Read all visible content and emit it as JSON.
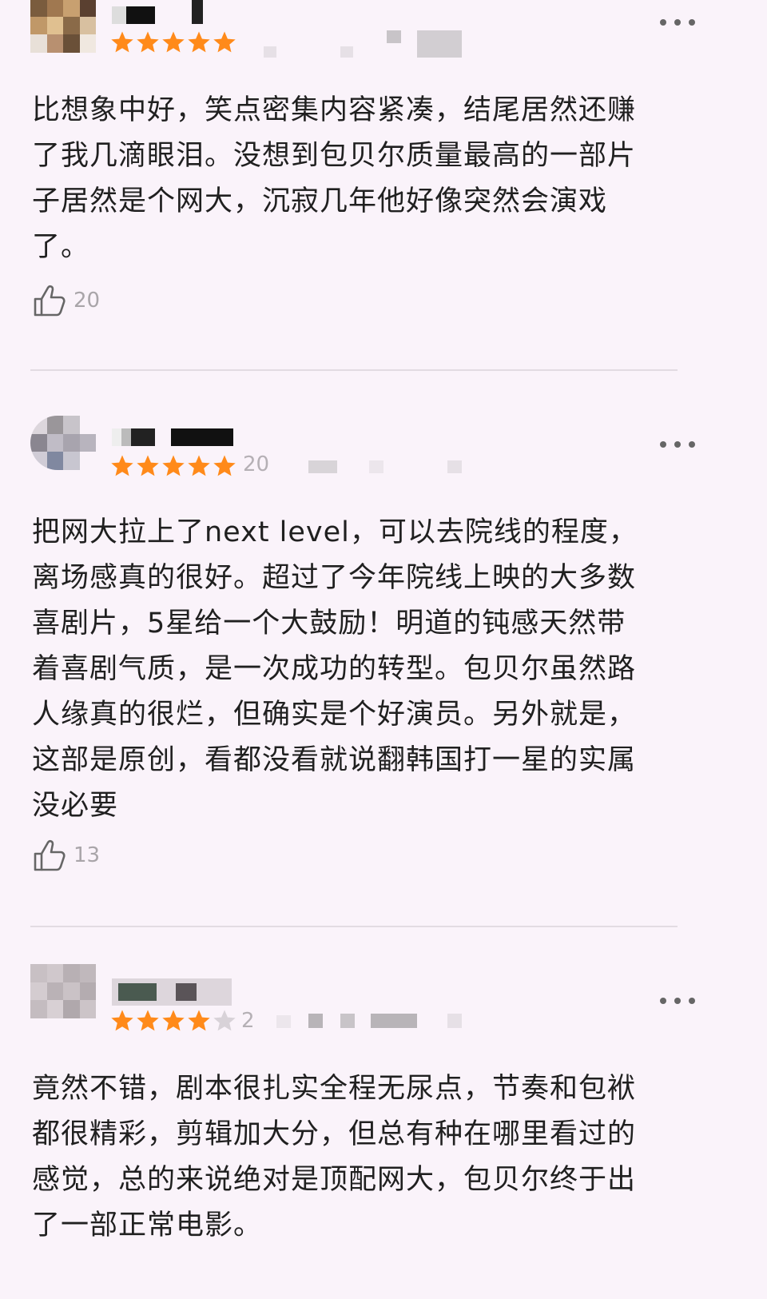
{
  "colors": {
    "background": "#faf3fa",
    "star_filled": "#ff8a1a",
    "star_empty": "#d8d2d8",
    "text": "#202020",
    "muted": "#a9a5a9",
    "divider": "#e2dbe2"
  },
  "icons": {
    "more": "more-horizontal-icon",
    "like": "thumbs-up-icon",
    "star": "star-icon"
  },
  "reviews": [
    {
      "rating": 5,
      "meta": "",
      "body": "比想象中好，笑点密集内容紧凑，结尾居然还赚\n了我几滴眼泪。没想到包贝尔质量最高的一部片\n子居然是个网大，沉寂几年他好像突然会演戏\n了。",
      "likes": "20"
    },
    {
      "rating": 5,
      "meta": "20",
      "body": "把网大拉上了next level，可以去院线的程度，\n离场感真的很好。超过了今年院线上映的大多数\n喜剧片，5星给一个大鼓励！明道的钝感天然带\n着喜剧气质，是一次成功的转型。包贝尔虽然路\n人缘真的很烂，但确实是个好演员。另外就是，\n这部是原创，看都没看就说翻韩国打一星的实属\n没必要",
      "likes": "13"
    },
    {
      "rating": 4,
      "meta": "2",
      "body": "竟然不错，剧本很扎实全程无尿点，节奏和包袱\n都很精彩，剪辑加大分，但总有种在哪里看过的\n感觉，总的来说绝对是顶配网大，包贝尔终于出\n了一部正常电影。",
      "likes": ""
    }
  ]
}
